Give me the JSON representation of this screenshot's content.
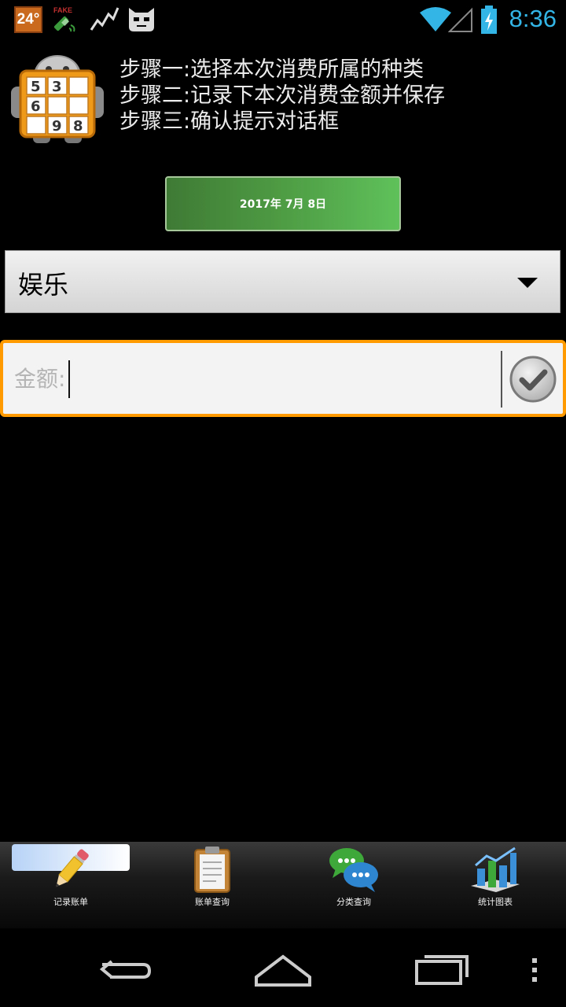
{
  "status_bar": {
    "temperature": "24°",
    "time": "8:36",
    "icons": [
      "weather-temp-icon",
      "fake-gps-icon",
      "activity-graph-icon",
      "cyanogen-mascot-icon",
      "wifi-icon",
      "cell-signal-icon",
      "battery-charging-icon"
    ],
    "fake_label": "FAKE"
  },
  "header": {
    "logo": "sudoku-robot-logo",
    "logo_digits": [
      "5",
      "3",
      "6",
      "9",
      "8"
    ],
    "steps": [
      "步骤一:选择本次消费所属的种类",
      "步骤二:记录下本次消费金额并保存",
      "步骤三:确认提示对话框"
    ]
  },
  "date_button": {
    "label": "2017年 7月 8日"
  },
  "category_spinner": {
    "selected": "娱乐"
  },
  "amount": {
    "placeholder": "金额:",
    "value": "",
    "confirm_icon": "checkmark-icon"
  },
  "tabs": [
    {
      "label": "记录账单",
      "icon": "pencil-icon",
      "selected": true
    },
    {
      "label": "账单查询",
      "icon": "clipboard-icon",
      "selected": false
    },
    {
      "label": "分类查询",
      "icon": "chat-bubbles-icon",
      "selected": false
    },
    {
      "label": "统计图表",
      "icon": "bar-chart-icon",
      "selected": false
    }
  ],
  "nav_bar": {
    "icons": [
      "back-icon",
      "home-icon",
      "recents-icon",
      "overflow-menu-icon"
    ]
  },
  "colors": {
    "accent_blue": "#33b5e5",
    "focus_orange": "#ff9a00",
    "date_green": "#4e9c44"
  }
}
